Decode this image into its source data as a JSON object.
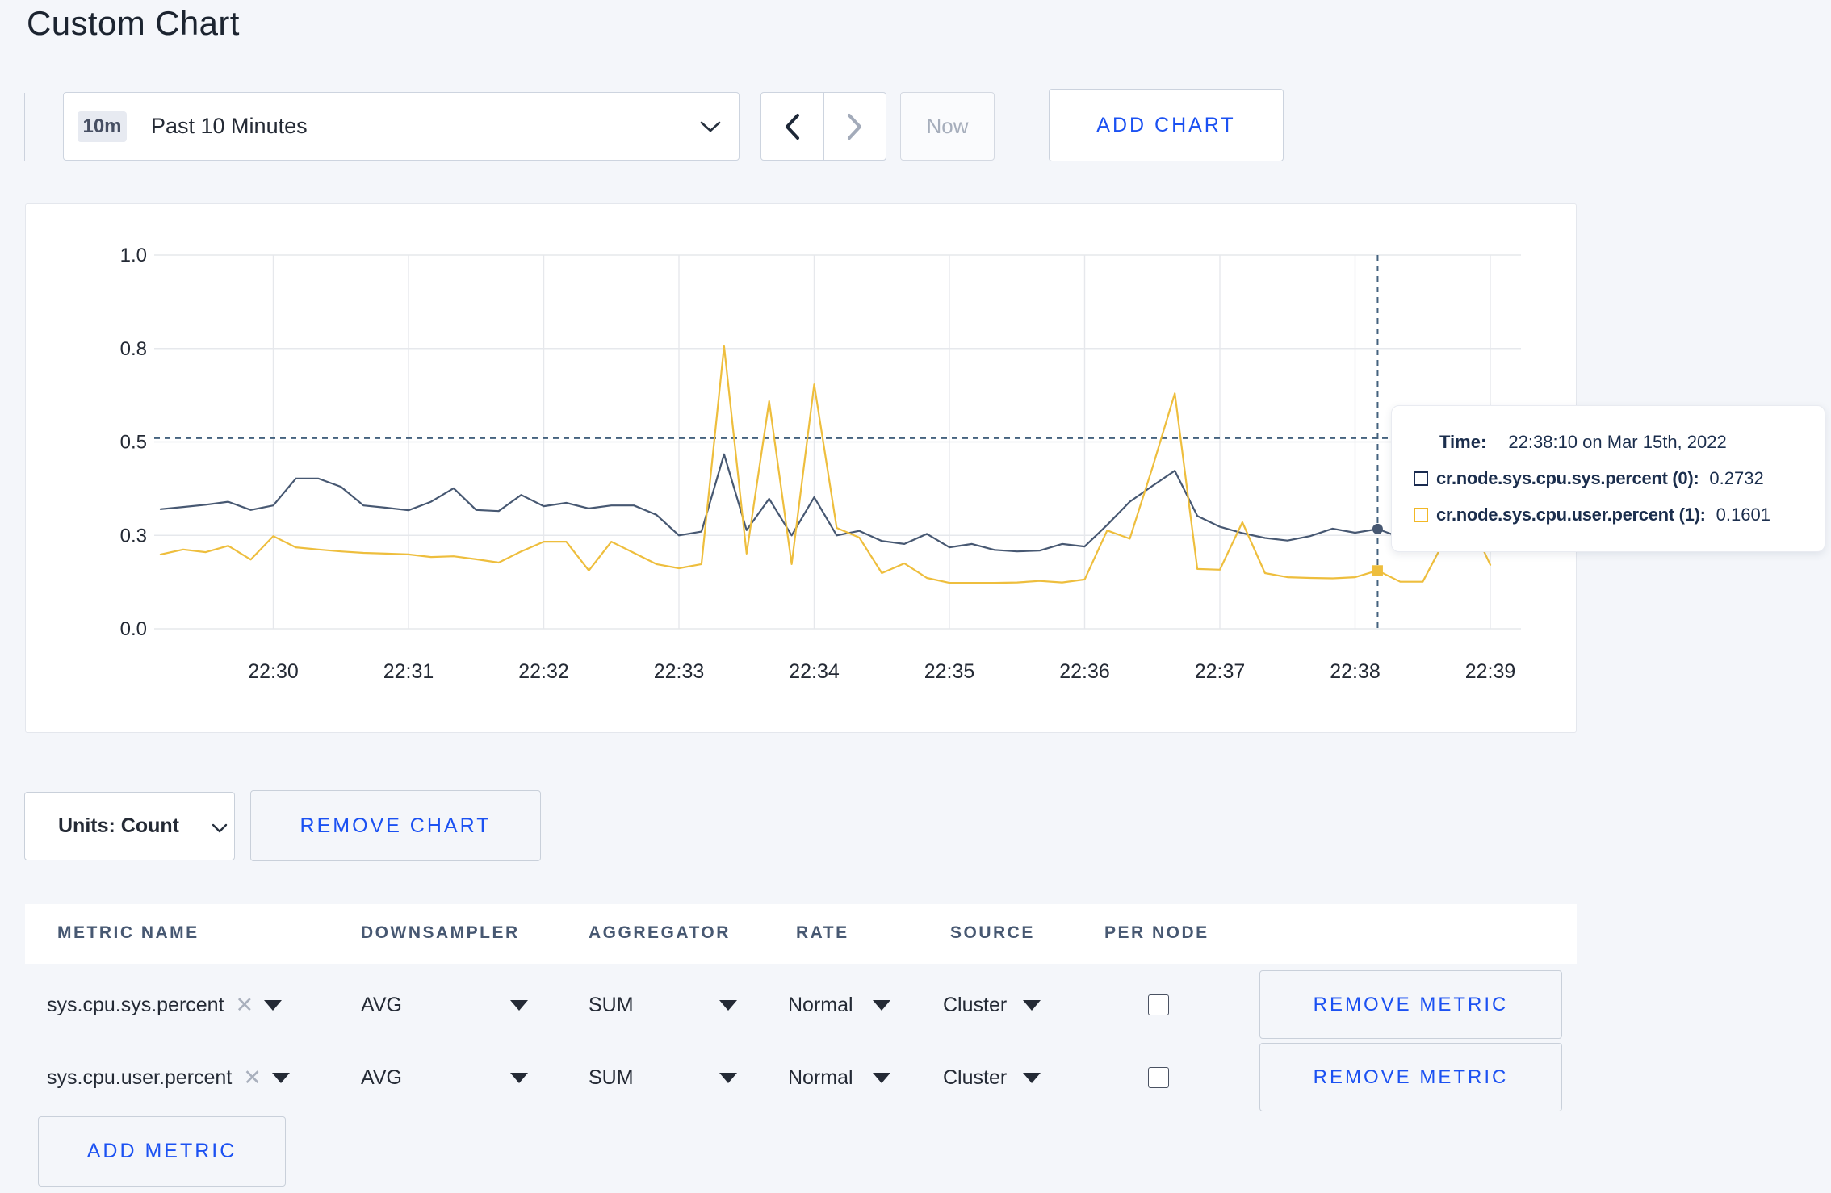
{
  "header": {
    "title": "Custom Chart"
  },
  "toolbar": {
    "timescale_badge": "10m",
    "timescale_label": "Past 10 Minutes",
    "now_label": "Now",
    "add_chart_label": "ADD CHART"
  },
  "chart_data": {
    "type": "line",
    "x_start": "22:29:10",
    "x_step_seconds": 10,
    "x_ticks": [
      "22:30",
      "22:31",
      "22:32",
      "22:33",
      "22:34",
      "22:35",
      "22:36",
      "22:37",
      "22:38",
      "22:39"
    ],
    "y_ticks": [
      {
        "v": 0.0,
        "label": "0.0"
      },
      {
        "v": 0.25,
        "label": "0.3"
      },
      {
        "v": 0.5,
        "label": "0.5"
      },
      {
        "v": 0.75,
        "label": "0.8"
      },
      {
        "v": 1.0,
        "label": "1.0"
      }
    ],
    "ylim": [
      0,
      1
    ],
    "grid": true,
    "series": [
      {
        "name": "cr.node.sys.cpu.sys.percent",
        "color": "#475872",
        "values": [
          0.32,
          0.326,
          0.332,
          0.34,
          0.318,
          0.33,
          0.402,
          0.402,
          0.38,
          0.33,
          0.324,
          0.317,
          0.34,
          0.376,
          0.318,
          0.315,
          0.358,
          0.328,
          0.337,
          0.322,
          0.33,
          0.33,
          0.305,
          0.25,
          0.26,
          0.467,
          0.264,
          0.348,
          0.25,
          0.352,
          0.25,
          0.262,
          0.235,
          0.227,
          0.254,
          0.218,
          0.227,
          0.211,
          0.207,
          0.209,
          0.227,
          0.22,
          0.278,
          0.34,
          0.382,
          0.423,
          0.302,
          0.273,
          0.256,
          0.243,
          0.236,
          0.248,
          0.268,
          0.257,
          0.267,
          0.245,
          0.25,
          0.27,
          0.3,
          0.28
        ]
      },
      {
        "name": "cr.node.sys.cpu.user.percent",
        "color": "#EEBE3D",
        "values": [
          0.199,
          0.212,
          0.205,
          0.222,
          0.185,
          0.248,
          0.218,
          0.212,
          0.207,
          0.203,
          0.201,
          0.199,
          0.192,
          0.194,
          0.186,
          0.177,
          0.207,
          0.233,
          0.233,
          0.156,
          0.233,
          0.203,
          0.173,
          0.162,
          0.173,
          0.756,
          0.201,
          0.609,
          0.173,
          0.654,
          0.27,
          0.244,
          0.149,
          0.175,
          0.136,
          0.123,
          0.123,
          0.123,
          0.124,
          0.128,
          0.124,
          0.132,
          0.263,
          0.241,
          0.43,
          0.63,
          0.16,
          0.158,
          0.285,
          0.149,
          0.138,
          0.136,
          0.135,
          0.138,
          0.156,
          0.126,
          0.126,
          0.24,
          0.3,
          0.171
        ]
      }
    ],
    "crosshair": {
      "index": 54,
      "y_value": 0.51,
      "color": "#44627e"
    },
    "highlight": {
      "sys_value": 0.267,
      "user_value": 0.156
    },
    "tooltip": {
      "time_label": "Time:",
      "time_value": "22:38:10 on Mar 15th, 2022",
      "rows": [
        {
          "label": "cr.node.sys.cpu.sys.percent (0):",
          "value": "0.2732",
          "swatch_color": "#1A2B50"
        },
        {
          "label": "cr.node.sys.cpu.user.percent (1):",
          "value": "0.1601",
          "swatch_color": "#F2B826"
        }
      ]
    }
  },
  "controls": {
    "units_label": "Units: Count",
    "remove_chart_label": "REMOVE CHART"
  },
  "table": {
    "columns": [
      "METRIC NAME",
      "DOWNSAMPLER",
      "AGGREGATOR",
      "RATE",
      "SOURCE",
      "PER NODE"
    ],
    "rows": [
      {
        "metric": "sys.cpu.sys.percent",
        "downsampler": "AVG",
        "aggregator": "SUM",
        "rate": "Normal",
        "source": "Cluster",
        "per_node_checked": false,
        "remove_label": "REMOVE METRIC"
      },
      {
        "metric": "sys.cpu.user.percent",
        "downsampler": "AVG",
        "aggregator": "SUM",
        "rate": "Normal",
        "source": "Cluster",
        "per_node_checked": false,
        "remove_label": "REMOVE METRIC"
      }
    ],
    "add_metric_label": "ADD METRIC"
  },
  "colors": {
    "accent_blue": "#1B51F2",
    "page_bg": "#F4F6FA",
    "series_sys": "#475872",
    "series_user": "#EEBE3D"
  }
}
